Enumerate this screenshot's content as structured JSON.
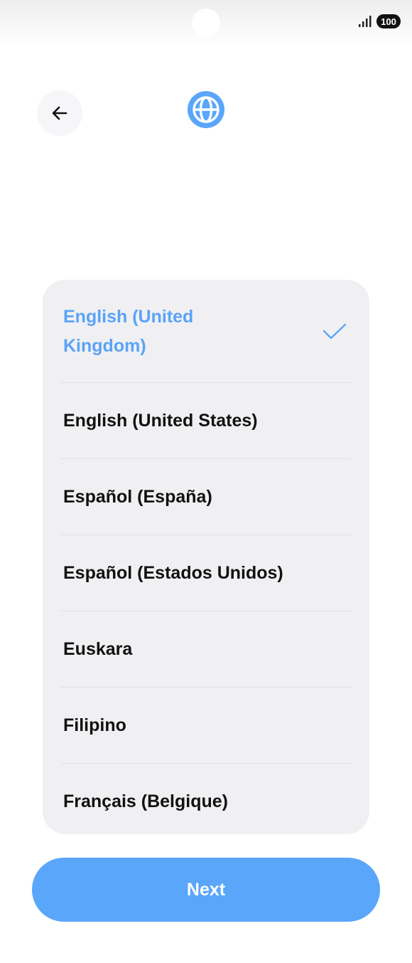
{
  "status_bar": {
    "battery": "100",
    "signal_icon": "signal-bars-icon"
  },
  "header": {
    "back_icon": "arrow-left-icon",
    "globe_icon": "globe-icon",
    "accent_color": "#5aa6fb"
  },
  "languages": [
    {
      "label": "English (United Kingdom)",
      "selected": true
    },
    {
      "label": "English (United States)",
      "selected": false
    },
    {
      "label": "Español (España)",
      "selected": false
    },
    {
      "label": "Español (Estados Unidos)",
      "selected": false
    },
    {
      "label": "Euskara",
      "selected": false
    },
    {
      "label": "Filipino",
      "selected": false
    },
    {
      "label": "Français (Belgique)",
      "selected": false
    }
  ],
  "footer": {
    "next_label": "Next"
  }
}
